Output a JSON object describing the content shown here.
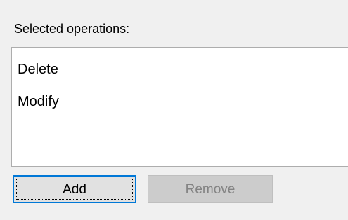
{
  "selection": {
    "heading": "Selected operations:",
    "items": [
      {
        "label": "Delete"
      },
      {
        "label": "Modify"
      }
    ]
  },
  "buttons": {
    "add_label": "Add",
    "remove_label": "Remove",
    "remove_enabled": false,
    "add_focused": true
  },
  "colors": {
    "window_bg": "#f0f0f0",
    "list_bg": "#ffffff",
    "focus_border": "#0078d7",
    "disabled_text": "#838383"
  }
}
